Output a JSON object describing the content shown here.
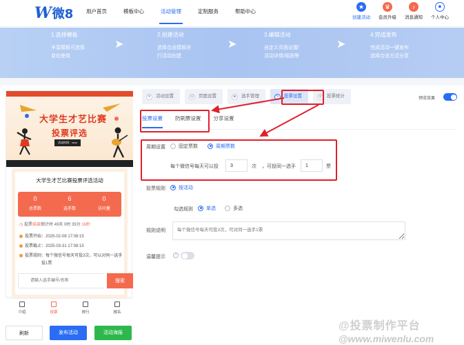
{
  "header": {
    "logo_letter": "W",
    "logo_text": "微8",
    "nav": [
      "用户首页",
      "模板中心",
      "活动管理",
      "定制服务",
      "帮助中心"
    ],
    "nav_active_index": 2,
    "user_items": [
      {
        "label": "创建活动",
        "icon": "create-activity-icon",
        "color": "#2a6df4"
      },
      {
        "label": "会员升级",
        "icon": "crown-icon",
        "color": "#f46a4e"
      },
      {
        "label": "消息通知",
        "icon": "bell-icon",
        "color": "#f46a4e"
      },
      {
        "label": "个人中心",
        "icon": "user-icon",
        "color": "#2a6df4"
      }
    ]
  },
  "steps": [
    {
      "title": "1.选择模板",
      "desc": [
        "丰富模板可选择",
        "变化使用"
      ]
    },
    {
      "title": "2.创建活动",
      "desc": [
        "选择合适模板进",
        "行活动创建"
      ]
    },
    {
      "title": "3.编辑活动",
      "desc": [
        "自定义页面设置/",
        "活动详情/规则等"
      ]
    },
    {
      "title": "4.完成发布",
      "desc": [
        "完成活动一键发布",
        "选择合适方式分享"
      ]
    }
  ],
  "preview": {
    "poster_title_1": "大学生才艺比赛",
    "poster_title_2": "投票评选",
    "poster_time": "活动时间：xxxx",
    "activity_title": "大学生才艺比赛投票评选活动",
    "stats": [
      {
        "value": "0",
        "label": "总票数"
      },
      {
        "value": "6",
        "label": "选手数"
      },
      {
        "value": "0",
        "label": "访问量"
      }
    ],
    "countdown_prefix": "投票",
    "countdown_red": "结束",
    "countdown_mid": "倒计时 49天 0时 35分 ",
    "countdown_sec": "16秒",
    "vote_start": "投票开始：2025-02-08 17:08:15",
    "vote_end": "投票截止：2025-03-31 17:08:15",
    "vote_rule": "投票规则：每个微信号每天可投3次，可以对同一选手",
    "vote_rule_2": "投1票",
    "search_placeholder": "请输入选手编号/名称",
    "search_button": "搜索",
    "tabbar": [
      "介绍",
      "投票",
      "排行",
      "报名"
    ],
    "tabbar_active": 1
  },
  "bottom_buttons": {
    "refresh": "刷新",
    "publish": "发布活动",
    "poster": "活动海报"
  },
  "content_tabs": [
    "活动设置",
    "页面设置",
    "选手管理",
    "投票设置",
    "投票统计"
  ],
  "content_tab_active": 3,
  "preview_toggle_label": "预览效果",
  "preview_toggle_on": true,
  "sub_tabs": [
    "投票设置",
    "防刷票设置",
    "分享设置"
  ],
  "sub_tab_active": 0,
  "form": {
    "cycle_label": "周期设置",
    "cycle_fixed": "固定票数",
    "cycle_period": "周期票数",
    "cycle_selected": "周期票数",
    "per_day_prefix": "每个微信号每天可以投",
    "per_day_value": "3",
    "per_day_unit": "次",
    "same_player_prefix": "，可投同一选手",
    "same_player_value": "1",
    "same_player_unit": "票",
    "vote_rule_label": "投票规则",
    "vote_rule_option": "按活动",
    "check_rule_label": "勾选规则",
    "check_single": "单选",
    "check_multi": "多选",
    "check_selected": "单选",
    "rule_desc_label": "规则说明",
    "rule_desc_placeholder": "每个微信号每天可投3次，可对同一选手1票",
    "tip_label": "温馨提示",
    "tip_toggle_on": false
  },
  "watermark": {
    "line1": "@投票制作平台",
    "line2": "@www.miwenlu.com"
  },
  "colors": {
    "brand": "#2a6df4",
    "accent": "#f46a4e",
    "highlight": "#e0202a",
    "green": "#2db84d"
  }
}
